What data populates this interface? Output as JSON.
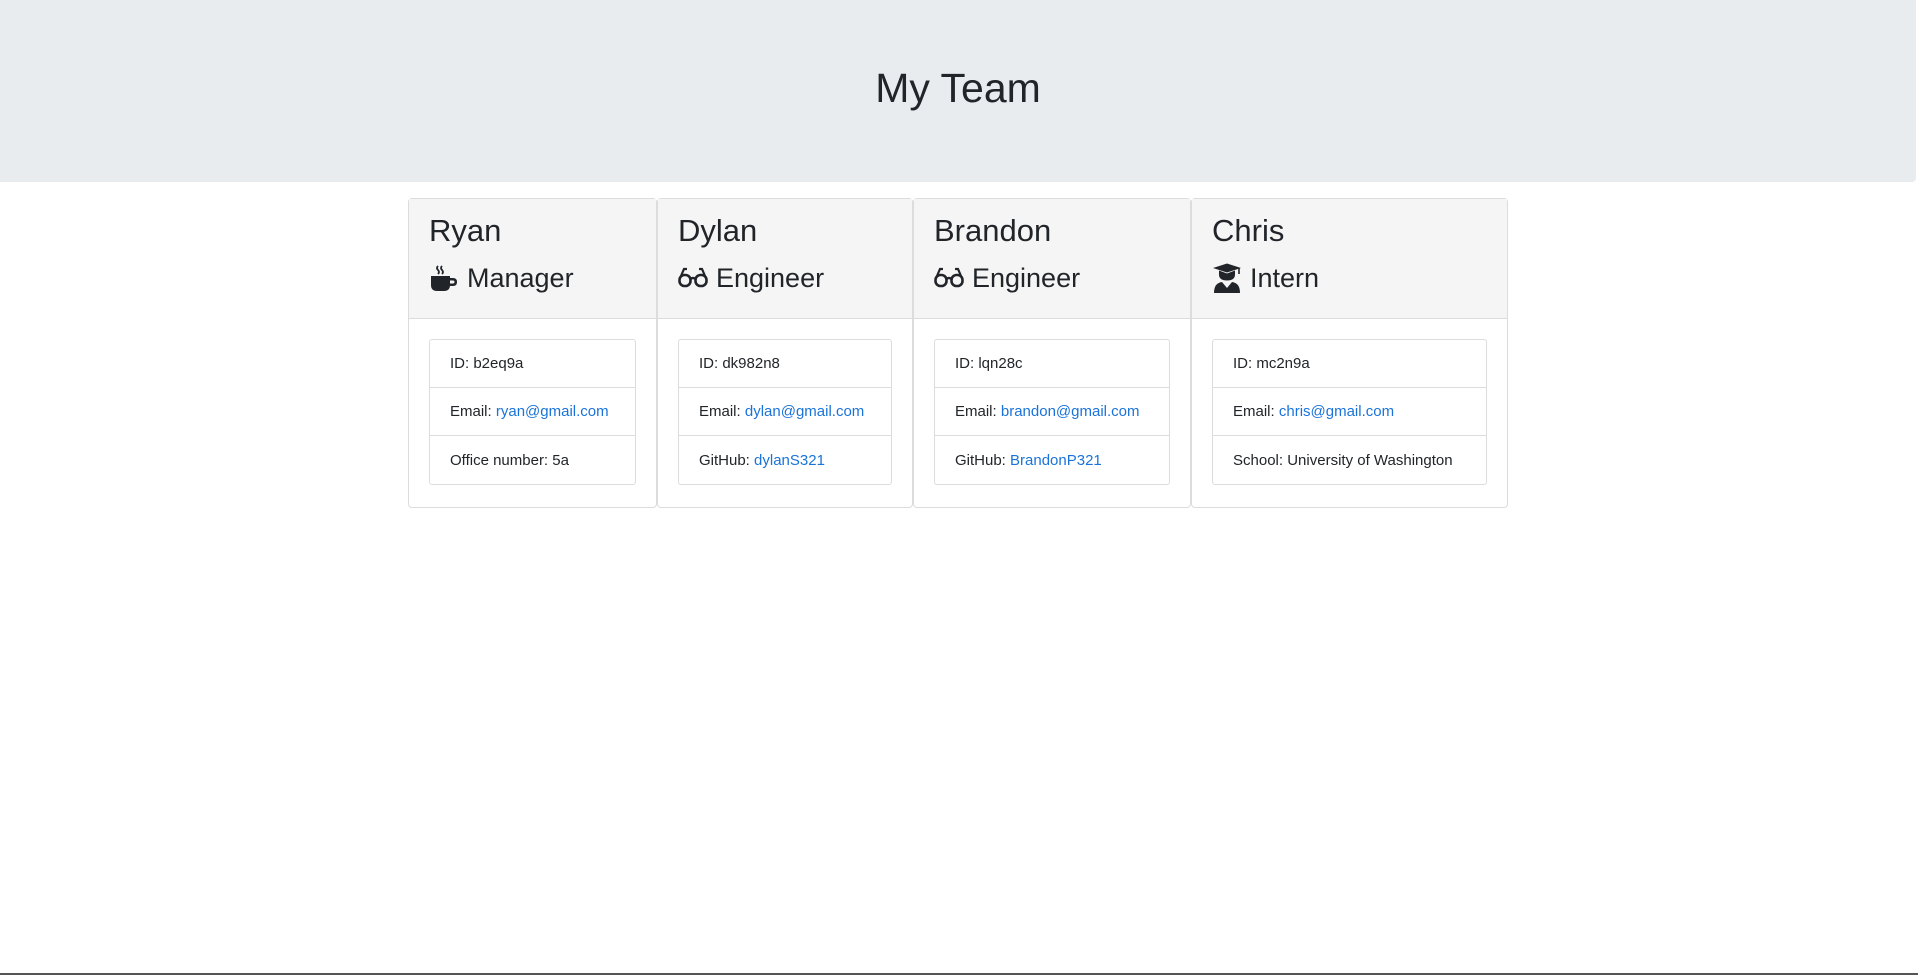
{
  "header": {
    "title": "My Team"
  },
  "colors": {
    "jumbotron_bg": "#e9ecef",
    "link": "#1a73d9",
    "card_header_bg": "#f5f5f5"
  },
  "members": [
    {
      "name": "Ryan",
      "role": "Manager",
      "role_icon": "mug-icon",
      "id_label": "ID:",
      "id": "b2eq9a",
      "email_label": "Email:",
      "email": "ryan@gmail.com",
      "extra_label": "Office number:",
      "extra_value": "5a"
    },
    {
      "name": "Dylan",
      "role": "Engineer",
      "role_icon": "glasses-icon",
      "id_label": "ID:",
      "id": "dk982n8",
      "email_label": "Email:",
      "email": "dylan@gmail.com",
      "extra_label": "GitHub:",
      "extra_value": "dylanS321"
    },
    {
      "name": "Brandon",
      "role": "Engineer",
      "role_icon": "glasses-icon",
      "id_label": "ID:",
      "id": "lqn28c",
      "email_label": "Email:",
      "email": "brandon@gmail.com",
      "extra_label": "GitHub:",
      "extra_value": "BrandonP321"
    },
    {
      "name": "Chris",
      "role": "Intern",
      "role_icon": "graduate-icon",
      "id_label": "ID:",
      "id": "mc2n9a",
      "email_label": "Email:",
      "email": "chris@gmail.com",
      "extra_label": "School:",
      "extra_value": "University of Washington"
    }
  ]
}
